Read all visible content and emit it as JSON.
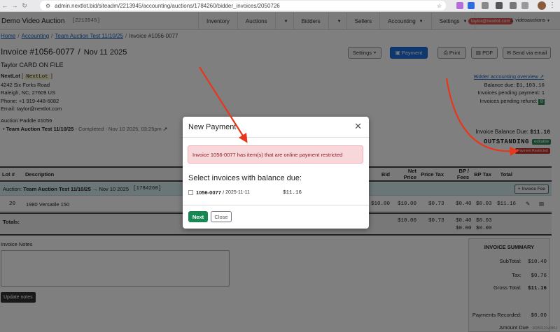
{
  "browser": {
    "url": "admin.nextlot.bid/siteadm/2213945/accounting/auctions/1784260/bidder_invoices/2050726"
  },
  "navbar": {
    "brand": "Demo Video Auction",
    "site_id": "[2213945]",
    "links": [
      "Inventory",
      "Auctions",
      "Bidders",
      "Sellers",
      "Accounting",
      "Settings"
    ],
    "user_email": "taylor@nextlot.com",
    "site_link": "videoauctions"
  },
  "breadcrumb": {
    "home": "Home",
    "accounting": "Accounting",
    "auction": "Team Auction Test 11/10/25",
    "current": "Invoice #1056-0077"
  },
  "invoice": {
    "title": "Invoice #1056-0077",
    "date": "Nov 11 2025",
    "customer": "Taylor CARD ON FILE",
    "company": "NextLot",
    "company_tag": "NextLot",
    "address1": "4242 Six Forks Road",
    "address2": "Raleigh, NC, 27609 US",
    "phone": "Phone: +1 919-448-6082",
    "email": "Email: taylor@nextlot.com",
    "paddle": "Auction Paddle #1056",
    "auction_name": "Team Auction Test 11/10/25",
    "auction_status": "- Completed - Nov 10 2025, 03:25pm"
  },
  "header_buttons": {
    "settings": "Settings",
    "payment": "Payment",
    "print": "Print",
    "pdf": "PDF",
    "email": "Send via email"
  },
  "accounting": {
    "overview_link": "Bidder accounting overview",
    "balance_due_label": "Balance due:",
    "balance_due_value": "$1,103.16",
    "pending_payment_label": "Invoices pending payment:",
    "pending_payment_value": "1",
    "pending_refund_label": "Invoices pending refund:",
    "pending_refund_value": "0",
    "invoice_balance_label": "Invoice Balance Due:",
    "invoice_balance_value": "$11.16",
    "status": "OUTSTANDING",
    "editable_badge": "editable",
    "restricted_badge": "Payment Restricted"
  },
  "table": {
    "headers": [
      "Lot #",
      "Description",
      "Bid",
      "Net Price",
      "Price Tax",
      "BP / Fees",
      "BP Tax",
      "Total"
    ],
    "auction_bar_label": "Auction:",
    "auction_bar_name": "Team Auction Test 11/10/25",
    "auction_bar_date": "→ Nov 10 2025",
    "auction_bar_id": "[1784260]",
    "invoice_fee_button": "+ Invoice Fee",
    "row": {
      "lot": "20",
      "description": "1980 Versatile 150",
      "bid": "$10.00",
      "net": "$10.00",
      "tax": "$0.73",
      "bp": "$0.40",
      "bptax": "$0.03",
      "total": "$11.16"
    },
    "totals_label": "Totals:",
    "totals": {
      "net": "$10.00",
      "tax": "$0.73",
      "bp1": "$0.40",
      "bp2": "$0.00",
      "bptax1": "$0.03",
      "bptax2": "$0.00"
    }
  },
  "notes": {
    "label": "Invoice Notes",
    "button": "Update notes"
  },
  "summary": {
    "title": "INVOICE SUMMARY",
    "subtotal_label": "SubTotal:",
    "subtotal": "$10.40",
    "tax_label": "Tax:",
    "tax": "$0.76",
    "gross_label": "Gross Total:",
    "gross": "$11.16",
    "recorded_label": "Payments Recorded:",
    "recorded": "$0.00",
    "amount_due_label": "Amount Due"
  },
  "modal": {
    "title": "New Payment",
    "alert": "Invoice 1056-0077 has item(s) that are online payment restricted",
    "subtitle": "Select invoices with balance due:",
    "invoice_number": "1056-0077",
    "invoice_sep": "/",
    "invoice_date": "2025-11-11",
    "invoice_amount": "$11.16",
    "next_button": "Next",
    "close_button": "Close"
  },
  "colors": {
    "primary": "#1f6fe0",
    "success": "#198754",
    "danger": "#c9302c",
    "alert_bg": "#f8d7da",
    "annotation_arrow": "#e8361c"
  },
  "watermark": "20251121v0901"
}
